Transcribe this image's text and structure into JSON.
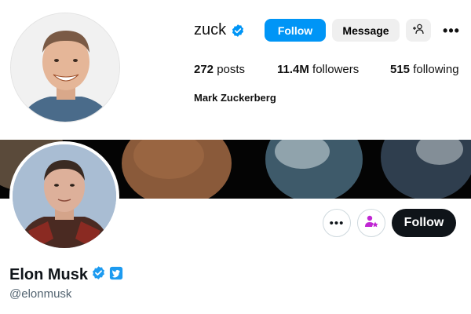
{
  "instagram": {
    "username": "zuck",
    "verified_icon": "verified-badge-icon",
    "follow_label": "Follow",
    "message_label": "Message",
    "add_user_icon": "add-user-icon",
    "more_icon": "more-horizontal-icon",
    "stats": {
      "posts_count": "272",
      "posts_label": "posts",
      "followers_count": "11.4M",
      "followers_label": "followers",
      "following_count": "515",
      "following_label": "following"
    },
    "full_name": "Mark Zuckerberg",
    "colors": {
      "follow_bg": "#0095f6",
      "secondary_bg": "#efefef",
      "verified": "#0095f6"
    }
  },
  "x": {
    "display_name": "Elon Musk",
    "handle": "@elonmusk",
    "follow_label": "Follow",
    "more_icon": "more-horizontal-icon",
    "subscribe_icon": "subscribe-star-icon",
    "colors": {
      "follow_bg": "#0f1419",
      "verified": "#1d9bf0",
      "subscribe": "#c026d3"
    }
  }
}
